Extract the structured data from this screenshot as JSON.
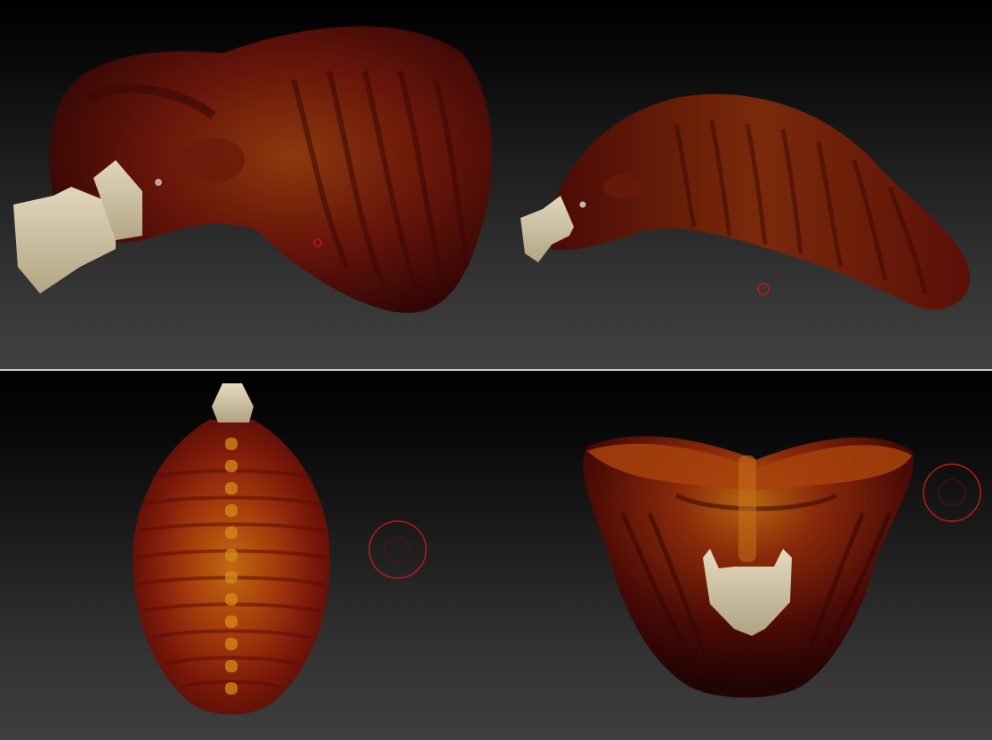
{
  "viewports": [
    {
      "name": "side-view",
      "subject": "creature-head-sculpt"
    },
    {
      "name": "side-view-long",
      "subject": "creature-head-sculpt"
    },
    {
      "name": "top-view",
      "subject": "creature-head-sculpt"
    },
    {
      "name": "front-view",
      "subject": "creature-head-sculpt"
    }
  ],
  "colors": {
    "flesh_dark": "#5a0f08",
    "flesh_mid": "#8a1c0c",
    "flesh_glow": "#b5550f",
    "bone": "#d8ccb0",
    "brush_ring": "#c01818"
  }
}
